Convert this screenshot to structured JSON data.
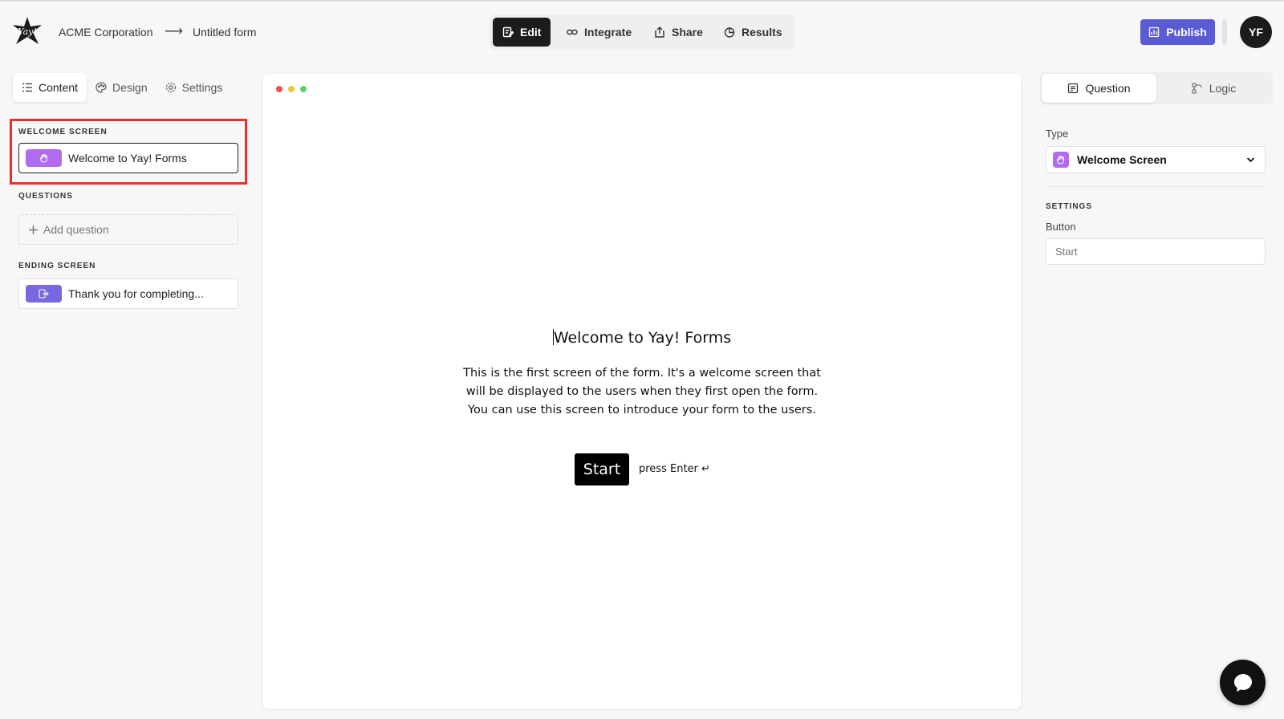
{
  "header": {
    "logo_text": "Yay!",
    "breadcrumb": {
      "org": "ACME Corporation",
      "arrow": "⟶",
      "form": "Untitled form"
    },
    "modes": [
      {
        "label": "Edit",
        "icon": "edit-icon",
        "active": true
      },
      {
        "label": "Integrate",
        "icon": "link-icon",
        "active": false
      },
      {
        "label": "Share",
        "icon": "share-icon",
        "active": false
      },
      {
        "label": "Results",
        "icon": "chart-pie-icon",
        "active": false
      }
    ],
    "publish_label": "Publish",
    "avatar_initials": "YF"
  },
  "left_panel": {
    "tabs": [
      {
        "label": "Content",
        "icon": "list-icon",
        "active": true
      },
      {
        "label": "Design",
        "icon": "palette-icon",
        "active": false
      },
      {
        "label": "Settings",
        "icon": "gear-icon",
        "active": false
      }
    ],
    "welcome_title": "WELCOME SCREEN",
    "welcome_card": "Welcome to Yay! Forms",
    "questions_title": "QUESTIONS",
    "add_question": "Add question",
    "ending_title": "ENDING SCREEN",
    "ending_card": "Thank you for completing..."
  },
  "preview": {
    "title": "Welcome to Yay! Forms",
    "body_lines": [
      "This is the first screen of the form. It's a welcome screen that",
      "will be displayed to the users when they first open the form.",
      "You can use this screen to introduce your form to the users."
    ],
    "start_label": "Start",
    "hint": "press Enter ↵"
  },
  "right_panel": {
    "tabs": [
      {
        "label": "Question",
        "icon": "question-form-icon",
        "active": true
      },
      {
        "label": "Logic",
        "icon": "logic-icon",
        "active": false
      }
    ],
    "type_label": "Type",
    "type_value": "Welcome Screen",
    "settings_title": "SETTINGS",
    "button_label": "Button",
    "button_placeholder": "Start"
  },
  "colors": {
    "accent": "#5b5bd6",
    "welcome_chip": "#b06bf0",
    "ending_chip": "#7868e0",
    "highlight": "#e5322d"
  }
}
